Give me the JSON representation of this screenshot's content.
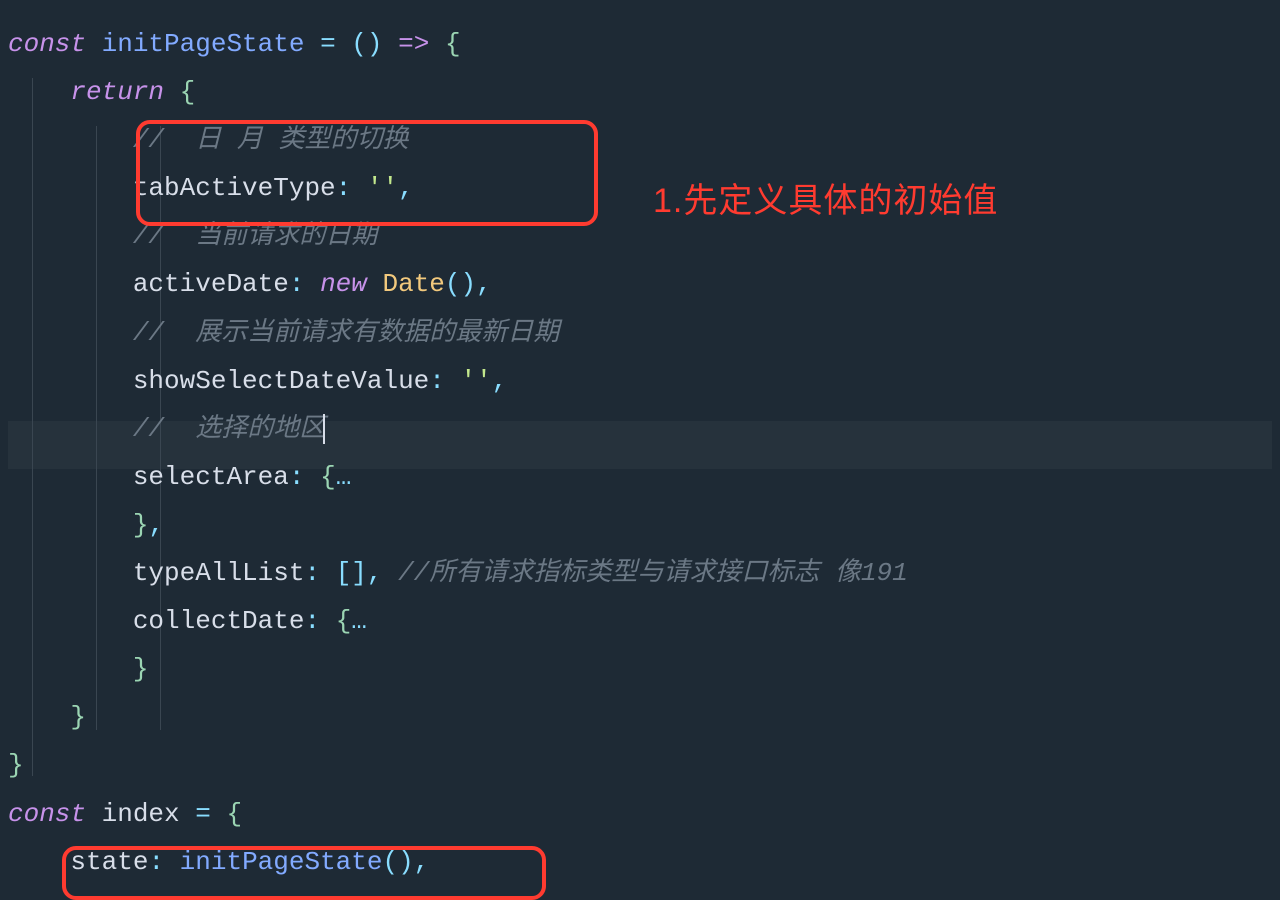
{
  "code": {
    "l1_kw1": "const",
    "l1_fn": "initPageState",
    "l1_op1": "=",
    "l1_paren": "()",
    "l1_arrow": "=>",
    "l1_brace": "{",
    "l2_kw": "return",
    "l2_brace": "{",
    "l3_comment": "//  日 月 类型的切换",
    "l4_prop": "tabActiveType",
    "l4_colon": ":",
    "l4_str": "''",
    "l4_comma": ",",
    "l5_comment": "//  当前请求的日期",
    "l6_prop": "activeDate",
    "l6_colon": ":",
    "l6_new": "new",
    "l6_cls": "Date",
    "l6_paren": "()",
    "l6_comma": ",",
    "l7_comment": "//  展示当前请求有数据的最新日期",
    "l8_prop": "showSelectDateValue",
    "l8_colon": ":",
    "l8_str": "''",
    "l8_comma": ",",
    "l9_comment": "//  选择的地区",
    "l10_prop": "selectArea",
    "l10_colon": ":",
    "l10_brace": "{",
    "l10_fold": "…",
    "l11_brace": "}",
    "l11_comma": ",",
    "l12_prop": "typeAllList",
    "l12_colon": ":",
    "l12_bracket": "[]",
    "l12_comma": ",",
    "l12_comment": "//所有请求指标类型与请求接口标志 像191",
    "l13_prop": "collectDate",
    "l13_colon": ":",
    "l13_brace": "{",
    "l13_fold": "…",
    "l14_brace": "}",
    "l15_brace": "}",
    "l16_brace": "}",
    "l17_kw": "const",
    "l17_prop": "index",
    "l17_op": "=",
    "l17_brace": "{",
    "l18_prop": "state",
    "l18_colon": ":",
    "l18_fn": "initPageState",
    "l18_paren": "()",
    "l18_comma": ","
  },
  "annotation": {
    "text": "1.先定义具体的初始值"
  }
}
